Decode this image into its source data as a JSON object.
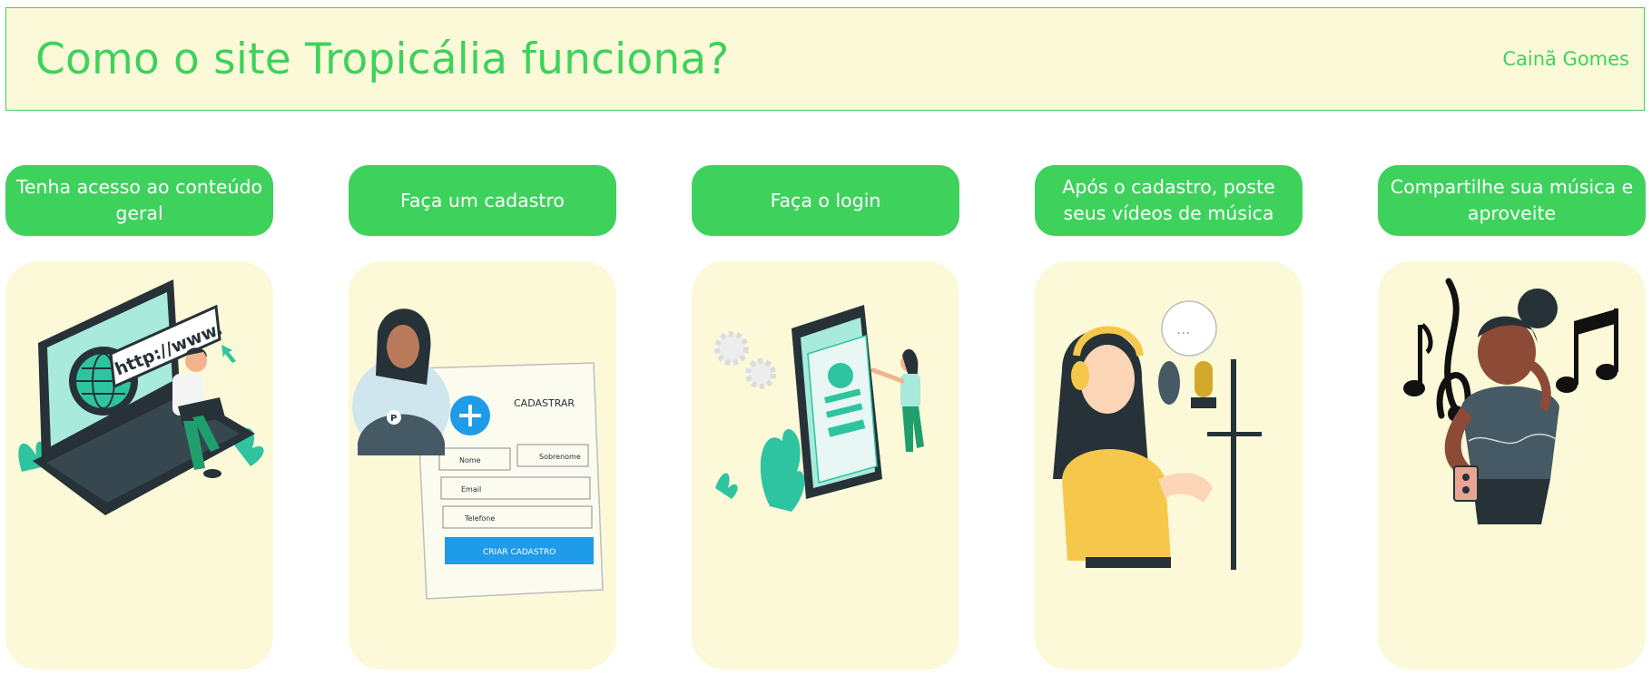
{
  "header": {
    "title": "Como o site Tropicália funciona?",
    "author": "Cainã Gomes"
  },
  "steps": [
    {
      "label": "Tenha acesso ao conteúdo geral",
      "illustration": "laptop-browser-illustration"
    },
    {
      "label": "Faça um cadastro",
      "illustration": "signup-form-illustration"
    },
    {
      "label": "Faça o login",
      "illustration": "phone-login-illustration"
    },
    {
      "label": "Após o cadastro, poste seus vídeos de música",
      "illustration": "singer-microphone-illustration"
    },
    {
      "label": "Compartilhe sua música e aproveite",
      "illustration": "music-listener-illustration"
    }
  ],
  "illustration_text": {
    "url": "http://www.",
    "form_title": "CADASTRAR",
    "field_name": "Nome",
    "field_surname": "Sobrenome",
    "field_email": "Email",
    "field_phone": "Telefone",
    "submit": "CRIAR CADASTRO",
    "avatar_letter": "P",
    "speech": "..."
  },
  "colors": {
    "accent": "#3ed25d",
    "panel": "#fcf9d8",
    "teal": "#2ec4a0",
    "dark": "#263238",
    "blue": "#1e9be9",
    "yellow": "#f5c84b"
  }
}
